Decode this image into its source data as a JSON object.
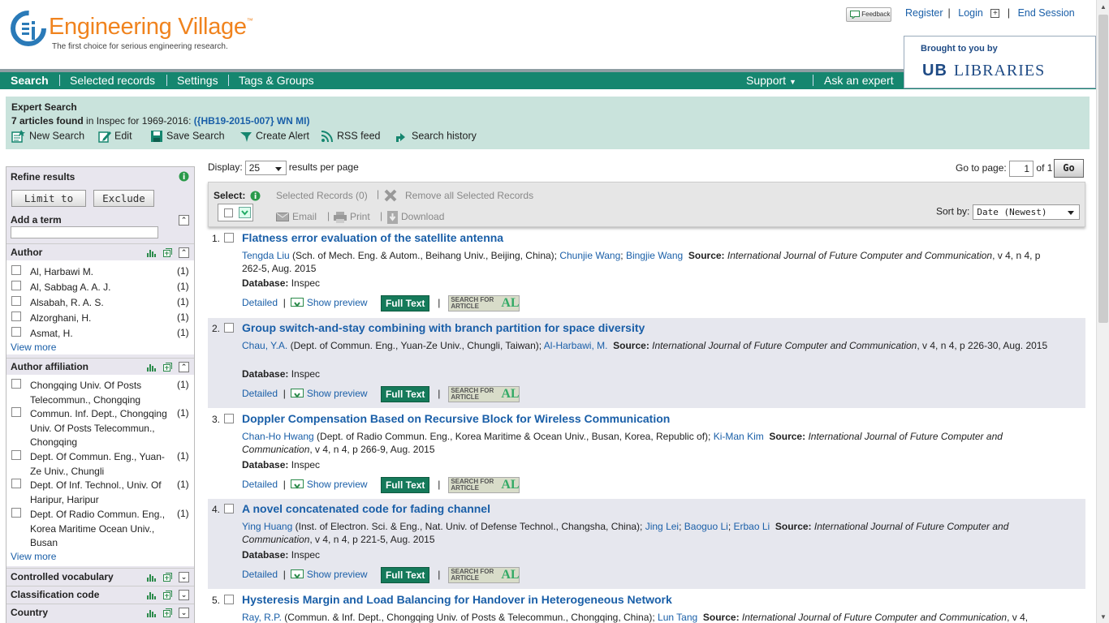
{
  "header": {
    "logo_title": "Engineering Village",
    "tm": "™",
    "tagline": "The first choice for serious engineering research.",
    "feedback": "Feedback",
    "register": "Register",
    "login": "Login",
    "end_session": "End Session",
    "brought_by": "Brought to you by",
    "library_mark": "UB",
    "library_name": "LIBRARIES"
  },
  "nav": {
    "search": "Search",
    "selected_records": "Selected records",
    "settings": "Settings",
    "tags_groups": "Tags & Groups",
    "support": "Support",
    "ask_expert": "Ask an expert"
  },
  "expert": {
    "title": "Expert Search",
    "count": "7 articles found",
    "in_text": " in Inspec for 1969-2016: ",
    "query": "({HB19-2015-007} WN MI)",
    "tools": [
      "New Search",
      "Edit",
      "Save Search",
      "Create Alert",
      "RSS feed",
      "Search history"
    ]
  },
  "refine": {
    "title": "Refine results",
    "limit": "Limit to",
    "exclude": "Exclude",
    "add_term": "Add a term",
    "author_title": "Author",
    "authors": [
      {
        "name": "Al, Harbawi M.",
        "count": "(1)"
      },
      {
        "name": "Al, Sabbag A. A. J.",
        "count": "(1)"
      },
      {
        "name": "Alsabah, R. A. S.",
        "count": "(1)"
      },
      {
        "name": "Alzorghani, H.",
        "count": "(1)"
      },
      {
        "name": "Asmat, H.",
        "count": "(1)"
      }
    ],
    "view_more": "View more",
    "affil_title": "Author affiliation",
    "affils": [
      {
        "name": "Chongqing Univ. Of Posts Telecommun., Chongqing",
        "count": "(1)"
      },
      {
        "name": "Commun. Inf. Dept., Chongqing Univ. Of Posts Telecommun., Chongqing",
        "count": "(1)"
      },
      {
        "name": "Dept. Of Commun. Eng., Yuan-Ze Univ., Chungli",
        "count": "(1)"
      },
      {
        "name": "Dept. Of Inf. Technol., Univ. Of Haripur, Haripur",
        "count": "(1)"
      },
      {
        "name": "Dept. Of Radio Commun. Eng., Korea Maritime Ocean Univ., Busan",
        "count": "(1)"
      }
    ],
    "controlled_vocab": "Controlled vocabulary",
    "classification_code": "Classification code",
    "country": "Country"
  },
  "results": {
    "display_label": "Display:",
    "display_value": "25",
    "per_page": "results per page",
    "goto_label": "Go to page:",
    "page": "1",
    "of": "of 1",
    "go": "Go",
    "select_label": "Select:",
    "selected_records": "Selected Records (0)",
    "remove_all": "Remove all Selected Records",
    "email": "Email",
    "print": "Print",
    "download": "Download",
    "sort_label": "Sort by:",
    "sort_value": "Date (Newest)",
    "detailed": "Detailed",
    "show_preview": "Show preview",
    "full_text": "Full Text",
    "sfa_line1": "SEARCH FOR",
    "sfa_line2": "ARTICLE",
    "sfa_logo": "AL",
    "database_label": "Database:",
    "database_value": "Inspec",
    "source_label": "Source:",
    "records": [
      {
        "num": "1.",
        "title": "Flatness error evaluation of the satellite antenna",
        "a1": "Tengda Liu",
        "a1_aff": " (Sch. of Mech. Eng. & Autom., Beihang Univ., Beijing, China); ",
        "a2": "Chunjie Wang",
        "a3": "Bingjie Wang",
        "journal": "International Journal of Future Computer and Communication",
        "citation": ", v 4, n 4, p 262-5, Aug. 2015"
      },
      {
        "num": "2.",
        "title": "Group switch-and-stay combining with branch partition for space diversity",
        "a1": "Chau, Y.A.",
        "a1_aff": " (Dept. of Commun. Eng., Yuan-Ze Univ., Chungli, Taiwan); ",
        "a2": "Al-Harbawi, M.",
        "journal": "International Journal of Future Computer and Communication",
        "citation": ", v 4, n 4, p 226-30, Aug. 2015"
      },
      {
        "num": "3.",
        "title": "Doppler Compensation Based on Recursive Block for Wireless Communication",
        "a1": "Chan-Ho Hwang",
        "a1_aff": " (Dept. of Radio Commun. Eng., Korea Maritime & Ocean Univ., Busan, Korea, Republic of); ",
        "a2": "Ki-Man Kim",
        "journal": "International Journal of Future Computer and Communication",
        "citation": ", v 4, n 4, p 266-9, Aug. 2015"
      },
      {
        "num": "4.",
        "title": "A novel concatenated code for fading channel",
        "a1": "Ying Huang",
        "a1_aff": " (Inst. of Electron. Sci. & Eng., Nat. Univ. of Defense Technol., Changsha, China); ",
        "a2": "Jing Lei",
        "a3": "Baoguo Li",
        "a4": "Erbao Li",
        "journal": "International Journal of Future Computer and Communication",
        "citation": ", v 4, n 4, p 221-5, Aug. 2015"
      },
      {
        "num": "5.",
        "title": "Hysteresis Margin and Load Balancing for Handover in Heterogeneous Network",
        "a1": "Ray, R.P.",
        "a1_aff": " (Commun. & Inf. Dept., Chongqing Univ. of Posts & Telecommun., Chongqing, China); ",
        "a2": "Lun Tang",
        "journal": "International Journal of Future Computer and Communication",
        "citation": ", v 4,"
      }
    ]
  },
  "colors": {
    "nav_green": "#15866f",
    "expert_bg": "#c9e3dc",
    "link_blue": "#1a5fa8",
    "logo_orange": "#f0831e"
  }
}
